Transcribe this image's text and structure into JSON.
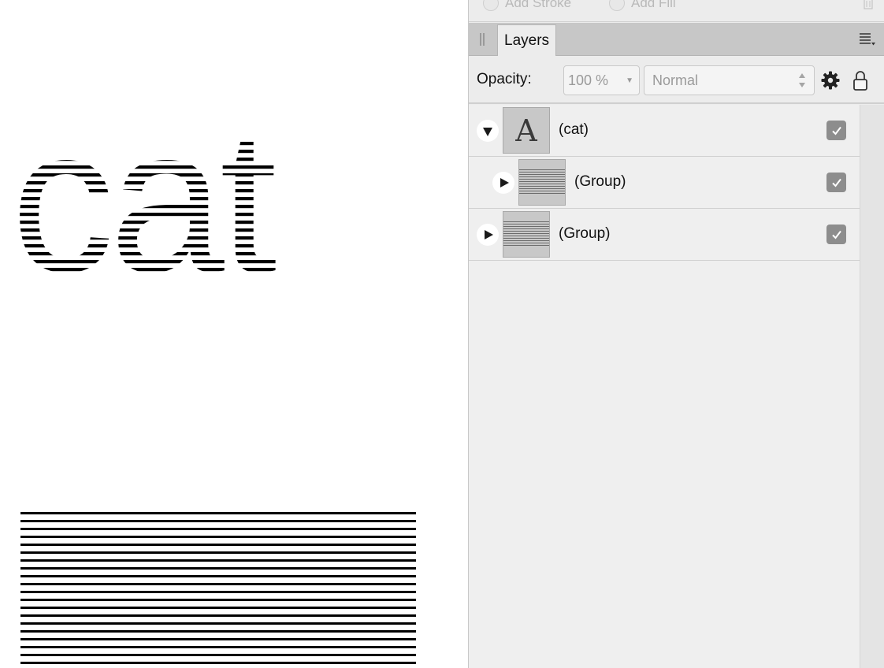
{
  "canvas": {
    "text_art": "cat"
  },
  "toolbar": {
    "add_stroke_label": "Add Stroke",
    "add_fill_label": "Add Fill",
    "trash_icon": "trash-icon"
  },
  "panel": {
    "tab_label": "Layers",
    "grip_icon": "grip-icon",
    "menu_icon": "panel-menu-icon",
    "opacity_label": "Opacity:",
    "opacity_value": "100 %",
    "blend_mode": "Normal",
    "gear_icon": "gear-icon",
    "lock_icon": "lock-icon"
  },
  "layers": [
    {
      "name": "(cat)",
      "thumb_glyph": "A",
      "expanded": true,
      "visible": true,
      "indent": 0
    },
    {
      "name": "(Group)",
      "expanded": false,
      "visible": true,
      "indent": 1
    },
    {
      "name": "(Group)",
      "expanded": false,
      "visible": true,
      "indent": 0
    }
  ],
  "colors": {
    "panel_bg": "#ececec",
    "tabbar_bg": "#c7c7c7",
    "checkbox": "#8d8d8d",
    "disabled_text": "#9a9a9a"
  }
}
